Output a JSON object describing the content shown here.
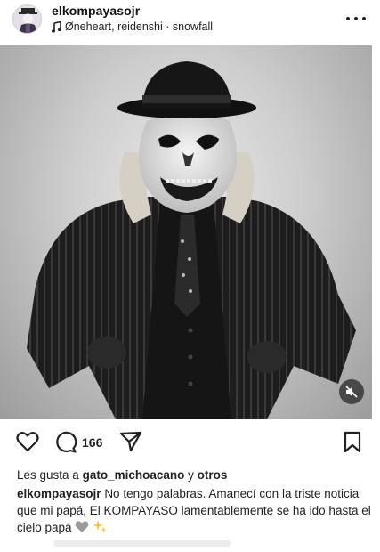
{
  "header": {
    "username": "elkompayasojr",
    "music": "Øneheart, reidenshi · snowfall",
    "avatar_icon": "profile-avatar-icon",
    "more_icon": "more-options-icon"
  },
  "post": {
    "image_alt": "",
    "mute_icon": "muted-speaker-icon"
  },
  "actions": {
    "like_icon": "heart-icon",
    "comment_icon": "comment-icon",
    "comment_count": "166",
    "share_icon": "send-icon",
    "save_icon": "bookmark-icon"
  },
  "likes": {
    "prefix": "Les gusta a",
    "user": "gato_michoacano",
    "joiner": "y",
    "others": "otros"
  },
  "caption": {
    "username": "elkompayasojr",
    "text": "No tengo palabras. Amanecí  con la triste noticia que mi papá, El KOMPAYASO lamentablemente se ha ido hasta el cielo papá",
    "emoji_1": "grey-heart-icon",
    "emoji_2": "sparkles-icon"
  },
  "colors": {
    "text": "#111111",
    "muted_bg": "#2a2a2a",
    "background": "#ffffff"
  }
}
